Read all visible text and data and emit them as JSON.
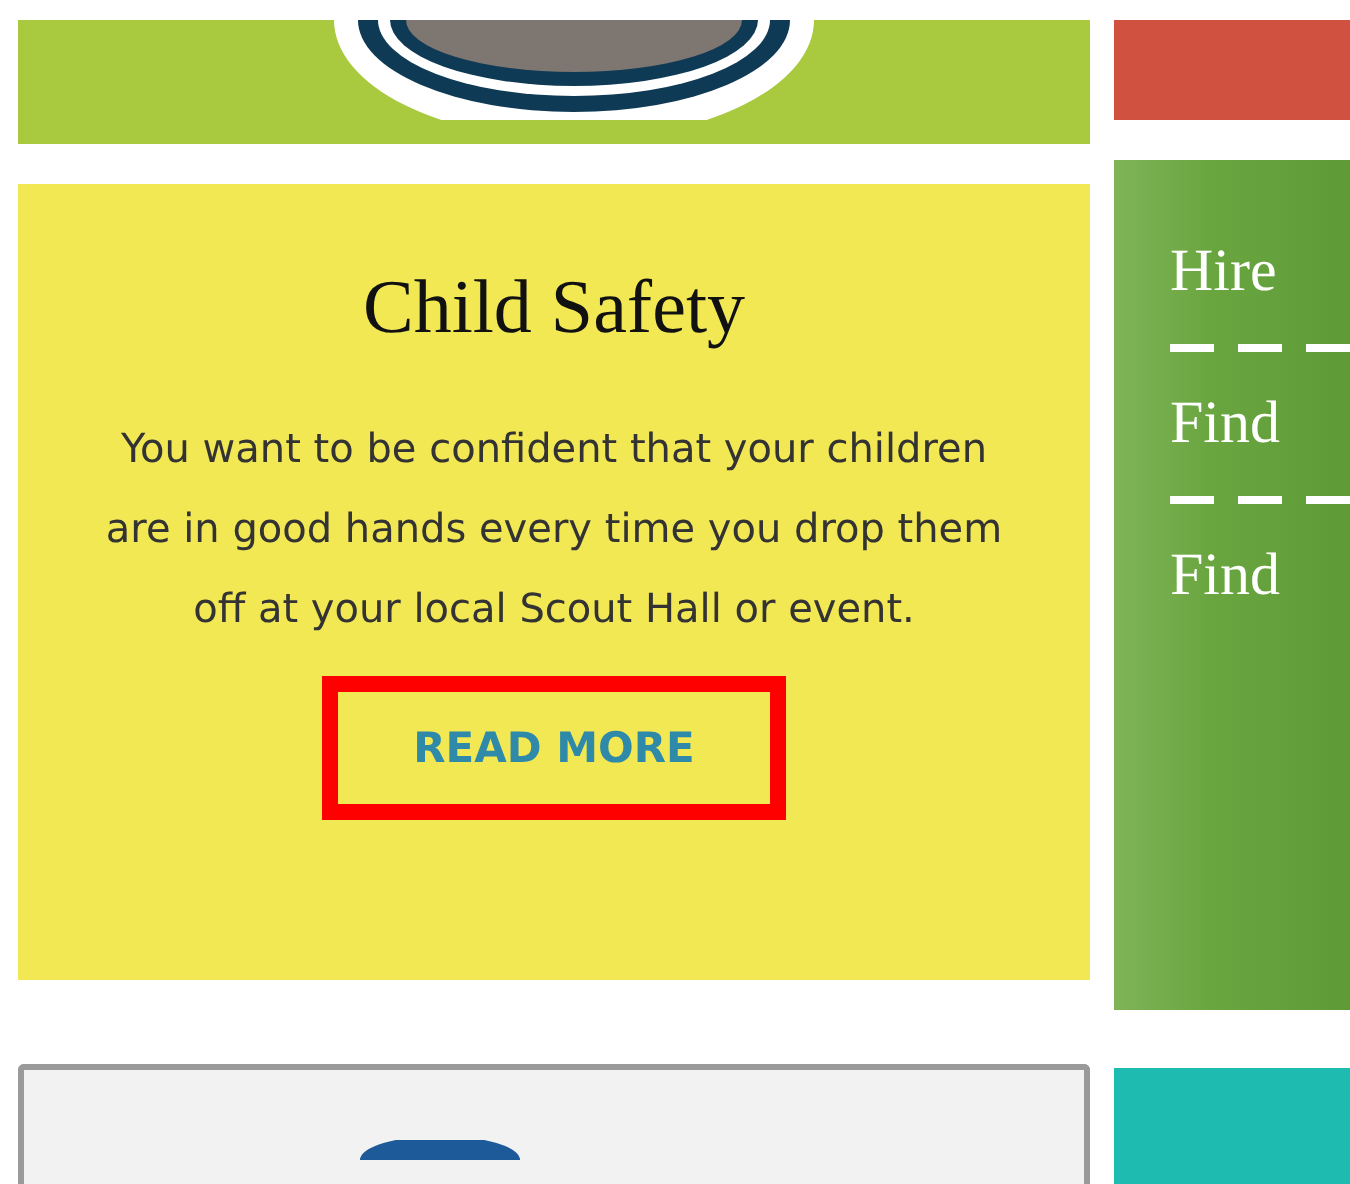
{
  "child_safety": {
    "title": "Child Safety",
    "body": "You want to be confident that your children are in good hands every time you drop them off at your local Scout Hall or event.",
    "button": "READ MORE",
    "highlighted": true
  },
  "side_links": [
    {
      "label": "Hire"
    },
    {
      "label": "Find"
    },
    {
      "label": "Find"
    }
  ]
}
